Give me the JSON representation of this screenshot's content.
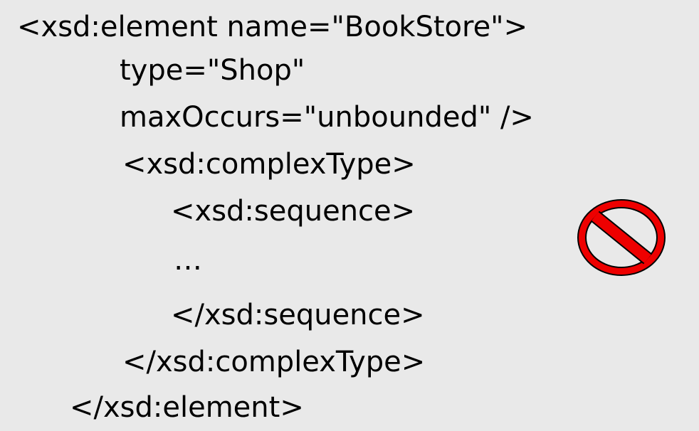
{
  "code": {
    "lines": [
      "<xsd:element name=\"BookStore\">",
      "type=\"Shop\"",
      "maxOccurs=\"unbounded\" />",
      "<xsd:complexType>",
      "<xsd:sequence>",
      "…",
      "</xsd:sequence>",
      "</xsd:complexType>",
      "</xsd:element>"
    ]
  },
  "icons": {
    "prohibition": {
      "name": "prohibition-icon",
      "fill": "#ee0000",
      "outline": "#000000"
    }
  },
  "colors": {
    "background": "#e9e9e9",
    "text": "#000000"
  }
}
